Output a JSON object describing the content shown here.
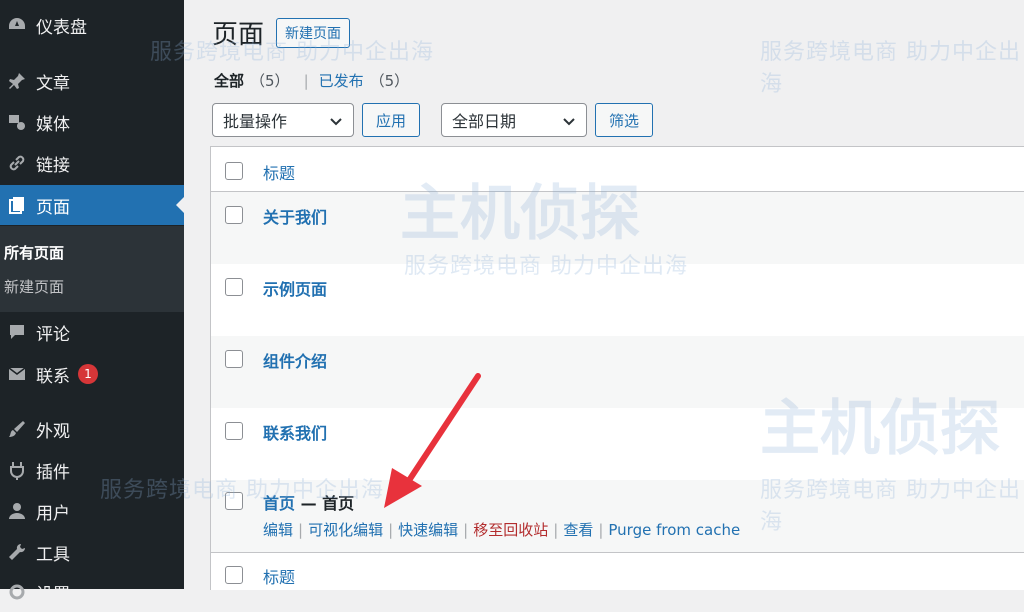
{
  "sidebar": {
    "items": [
      {
        "label": "仪表盘",
        "icon": "dashboard-icon"
      },
      {
        "label": "文章",
        "icon": "pin-icon"
      },
      {
        "label": "媒体",
        "icon": "media-icon"
      },
      {
        "label": "链接",
        "icon": "link-icon"
      },
      {
        "label": "页面",
        "icon": "pages-icon",
        "active": true
      },
      {
        "label": "评论",
        "icon": "comment-icon"
      },
      {
        "label": "联系",
        "icon": "mail-icon",
        "badge": "1"
      },
      {
        "label": "外观",
        "icon": "brush-icon"
      },
      {
        "label": "插件",
        "icon": "plugin-icon"
      },
      {
        "label": "用户",
        "icon": "user-icon"
      },
      {
        "label": "工具",
        "icon": "wrench-icon"
      },
      {
        "label": "设置",
        "icon": "settings-icon"
      }
    ],
    "submenu": [
      "所有页面",
      "新建页面"
    ]
  },
  "header": {
    "title": "页面",
    "add_new": "新建页面"
  },
  "filters": {
    "all": "全部",
    "all_count": "（5）",
    "sep": "|",
    "published": "已发布",
    "published_count": "（5）"
  },
  "toolbar": {
    "bulk_select": "批量操作",
    "apply": "应用",
    "date_select": "全部日期",
    "filter": "筛选"
  },
  "table": {
    "header": "标题",
    "footer": "标题",
    "rows": [
      {
        "title": "关于我们"
      },
      {
        "title": "示例页面"
      },
      {
        "title": "组件介绍"
      },
      {
        "title": "联系我们"
      },
      {
        "title": "首页",
        "state": " — 首页"
      }
    ],
    "row_actions": [
      "编辑",
      "可视化编辑",
      "快速编辑",
      "移至回收站",
      "查看",
      "Purge from cache"
    ]
  },
  "watermark": {
    "brand": "主机侦探",
    "slogan": "服务跨境电商 助力中企出海"
  },
  "colors": {
    "accent": "#2271b1",
    "sidebar": "#1d2327",
    "trash": "#b32d2e",
    "badge": "#d63638",
    "arrow": "#e8323c"
  }
}
